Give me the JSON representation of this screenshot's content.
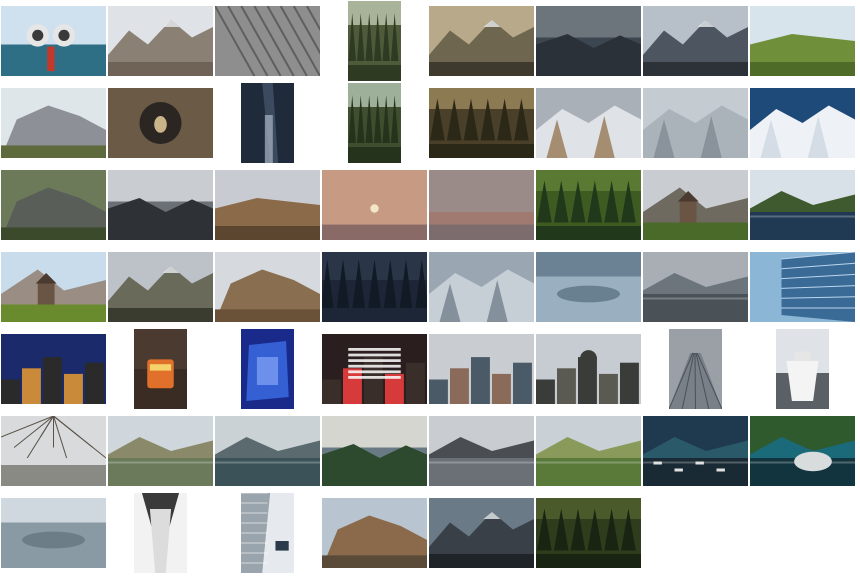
{
  "gallery": {
    "rows": [
      [
        {
          "kind": "binocular",
          "orient": "land",
          "sky": "#cfe0ee",
          "mid": "#2f6f86",
          "ground": "#1d3d52"
        },
        {
          "kind": "mountain",
          "orient": "land",
          "sky": "#dfe2e6",
          "mid": "#8a8073",
          "ground": "#6e6356"
        },
        {
          "kind": "texture",
          "orient": "land",
          "sky": "#c9c9c9",
          "mid": "#8e8e8e",
          "ground": "#5f5f5f"
        },
        {
          "kind": "forest",
          "orient": "port",
          "sky": "#a9b39a",
          "mid": "#4e5a3a",
          "ground": "#2f3a22"
        },
        {
          "kind": "mountain",
          "orient": "land",
          "sky": "#b8a98a",
          "mid": "#6f6650",
          "ground": "#3e3a2d"
        },
        {
          "kind": "valley",
          "orient": "land",
          "sky": "#6c747c",
          "mid": "#3c4650",
          "ground": "#2a3138"
        },
        {
          "kind": "mountain",
          "orient": "land",
          "sky": "#b7c0c8",
          "mid": "#4d5660",
          "ground": "#2c3238"
        },
        {
          "kind": "field",
          "orient": "land",
          "sky": "#d7e4ec",
          "mid": "#6f8f3a",
          "ground": "#4e6c28"
        }
      ],
      [
        {
          "kind": "rock",
          "orient": "land",
          "sky": "#dfe6ea",
          "mid": "#8d9096",
          "ground": "#5f6a3c"
        },
        {
          "kind": "tunnel",
          "orient": "land",
          "sky": "#2b2622",
          "mid": "#6a5a46",
          "ground": "#c9b48a"
        },
        {
          "kind": "gorge",
          "orient": "port",
          "sky": "#3c4a60",
          "mid": "#1f2a3a",
          "ground": "#9aa8b8"
        },
        {
          "kind": "forest",
          "orient": "port",
          "sky": "#9fb09a",
          "mid": "#3e4e2e",
          "ground": "#26331c"
        },
        {
          "kind": "forest",
          "orient": "land",
          "sky": "#8c7a52",
          "mid": "#4a3f28",
          "ground": "#2c2818"
        },
        {
          "kind": "snow",
          "orient": "land",
          "sky": "#aab0b8",
          "mid": "#8c6a40",
          "ground": "#dfe2e6"
        },
        {
          "kind": "snow",
          "orient": "land",
          "sky": "#c4ccd2",
          "mid": "#7c858e",
          "ground": "#aab2ba"
        },
        {
          "kind": "snow",
          "orient": "land",
          "sky": "#1e4a7a",
          "mid": "#c9d4de",
          "ground": "#eef2f6"
        }
      ],
      [
        {
          "kind": "rock",
          "orient": "land",
          "sky": "#6c7a5a",
          "mid": "#5a5e58",
          "ground": "#3a4a2a"
        },
        {
          "kind": "fog",
          "orient": "land",
          "sky": "#c9ccd0",
          "mid": "#6a7076",
          "ground": "#2e3236"
        },
        {
          "kind": "hill",
          "orient": "land",
          "sky": "#c8ccd2",
          "mid": "#8a6a48",
          "ground": "#5c4630"
        },
        {
          "kind": "moon",
          "orient": "land",
          "sky": "#c79a84",
          "mid": "#b88a78",
          "ground": "#8a6a66"
        },
        {
          "kind": "sunset",
          "orient": "land",
          "sky": "#9a8a88",
          "mid": "#a07a70",
          "ground": "#7c6c6e"
        },
        {
          "kind": "forest",
          "orient": "land",
          "sky": "#5a7a34",
          "mid": "#3e5c22",
          "ground": "#22381a"
        },
        {
          "kind": "chapel",
          "orient": "land",
          "sky": "#c9ccd0",
          "mid": "#6e6a60",
          "ground": "#4a6a2a"
        },
        {
          "kind": "lake",
          "orient": "land",
          "sky": "#d8e0e8",
          "mid": "#3f5a2e",
          "ground": "#1f3a52"
        }
      ],
      [
        {
          "kind": "church",
          "orient": "land",
          "sky": "#c9dceb",
          "mid": "#9a8e84",
          "ground": "#6a8a2e"
        },
        {
          "kind": "mountain",
          "orient": "land",
          "sky": "#bcc2c8",
          "mid": "#6a6a5a",
          "ground": "#3a3c30"
        },
        {
          "kind": "ruin",
          "orient": "land",
          "sky": "#d6dade",
          "mid": "#8a6e50",
          "ground": "#6a5238"
        },
        {
          "kind": "night",
          "orient": "land",
          "sky": "#2a3648",
          "mid": "#1c2636",
          "ground": "#121a26"
        },
        {
          "kind": "snowtree",
          "orient": "land",
          "sky": "#9aa6b2",
          "mid": "#6a7684",
          "ground": "#c6ced6"
        },
        {
          "kind": "aerial",
          "orient": "land",
          "sky": "#6a8294",
          "mid": "#9ab0c0",
          "ground": "#4a6072"
        },
        {
          "kind": "shore",
          "orient": "land",
          "sky": "#a8aeb4",
          "mid": "#6c747c",
          "ground": "#4a5258"
        },
        {
          "kind": "glass",
          "orient": "land",
          "sky": "#8cb6d6",
          "mid": "#3a6a96",
          "ground": "#1f3a5a"
        }
      ],
      [
        {
          "kind": "city",
          "orient": "land",
          "sky": "#1a2a6a",
          "mid": "#c98a3a",
          "ground": "#2a2a2a"
        },
        {
          "kind": "tram",
          "orient": "port",
          "sky": "#4a3a30",
          "mid": "#e0702a",
          "ground": "#3a2c22"
        },
        {
          "kind": "blue",
          "orient": "port",
          "sky": "#1a2a8a",
          "mid": "#3a6ae0",
          "ground": "#0e1650"
        },
        {
          "kind": "globus",
          "orient": "land",
          "sky": "#2a1e1e",
          "mid": "#d63a3a",
          "ground": "#3a2e2a"
        },
        {
          "kind": "town",
          "orient": "land",
          "sky": "#c9ccd0",
          "mid": "#8a6a58",
          "ground": "#4a5a66"
        },
        {
          "kind": "dome",
          "orient": "land",
          "sky": "#c6ccd2",
          "mid": "#5a5a52",
          "ground": "#3a3c3a"
        },
        {
          "kind": "rail",
          "orient": "port",
          "sky": "#9aa0a6",
          "mid": "#7a8088",
          "ground": "#4a5058"
        },
        {
          "kind": "ship",
          "orient": "port",
          "sky": "#dfe2e6",
          "mid": "#f4f4f4",
          "ground": "#5a6066"
        }
      ],
      [
        {
          "kind": "branches",
          "orient": "land",
          "sky": "#d8dadc",
          "mid": "#5a5248",
          "ground": "#8a8a84"
        },
        {
          "kind": "marsh",
          "orient": "land",
          "sky": "#cfd6dc",
          "mid": "#8a8a6a",
          "ground": "#6a7a5a"
        },
        {
          "kind": "lake",
          "orient": "land",
          "sky": "#cad2d6",
          "mid": "#5a6a6e",
          "ground": "#3a5258"
        },
        {
          "kind": "valley",
          "orient": "land",
          "sky": "#d6d6d0",
          "mid": "#6a7a84",
          "ground": "#2e4a2e"
        },
        {
          "kind": "wave",
          "orient": "land",
          "sky": "#c9ccd0",
          "mid": "#4a4e52",
          "ground": "#6a7076"
        },
        {
          "kind": "pond",
          "orient": "land",
          "sky": "#c9d0d6",
          "mid": "#8a9a5a",
          "ground": "#5a7a3a"
        },
        {
          "kind": "boats",
          "orient": "land",
          "sky": "#1f3a4e",
          "mid": "#2a5a6a",
          "ground": "#1a2a34"
        },
        {
          "kind": "boulder",
          "orient": "land",
          "sky": "#2e5a2e",
          "mid": "#1a6a7a",
          "ground": "#12343e"
        }
      ],
      [
        {
          "kind": "aerial",
          "orient": "land",
          "sky": "#cfd8de",
          "mid": "#8a9aa4",
          "ground": "#5a6a74"
        },
        {
          "kind": "arch",
          "orient": "port",
          "sky": "#3a3a3a",
          "mid": "#dcdcdc",
          "ground": "#7a7a7a"
        },
        {
          "kind": "building",
          "orient": "port",
          "sky": "#e6eaee",
          "mid": "#9aa4ac",
          "ground": "#2a3a4a"
        },
        {
          "kind": "ruin",
          "orient": "land",
          "sky": "#b8c4d0",
          "mid": "#8a6a4a",
          "ground": "#5a4a38"
        },
        {
          "kind": "peak",
          "orient": "land",
          "sky": "#6a7a86",
          "mid": "#3a4048",
          "ground": "#1e2428"
        },
        {
          "kind": "forest",
          "orient": "land",
          "sky": "#4a5a2a",
          "mid": "#2e3e1c",
          "ground": "#1a2412"
        }
      ]
    ]
  }
}
